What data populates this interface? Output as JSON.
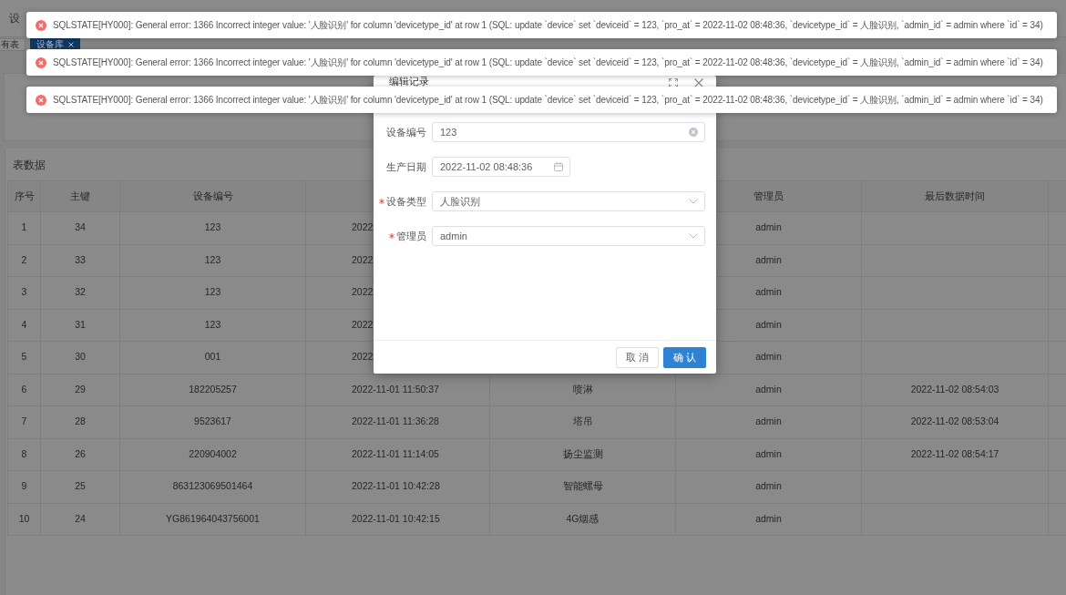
{
  "header": {
    "title": "设"
  },
  "tabs": [
    {
      "label": "有表",
      "selected": false,
      "closable": false
    },
    {
      "label": "设备库",
      "selected": true,
      "closable": true
    }
  ],
  "table": {
    "title": "表数据",
    "columns": {
      "index": "序号",
      "primary_key": "主键",
      "device_no": "设备编号",
      "admin": "管理员",
      "last_data_time": "最后数据时间"
    },
    "rows": [
      {
        "index": "1",
        "primary_key": "34",
        "device_no": "123",
        "column_4": "2022",
        "admin": "admin"
      },
      {
        "index": "2",
        "primary_key": "33",
        "device_no": "123",
        "column_4": "2022",
        "admin": "admin"
      },
      {
        "index": "3",
        "primary_key": "32",
        "device_no": "123",
        "column_4": "2022",
        "admin": "admin"
      },
      {
        "index": "4",
        "primary_key": "31",
        "device_no": "123",
        "column_4": "2022",
        "admin": "admin"
      },
      {
        "index": "5",
        "primary_key": "30",
        "device_no": "001",
        "column_4": "2022",
        "admin": "admin"
      },
      {
        "index": "6",
        "primary_key": "29",
        "device_no": "182205257",
        "column_4": "2022-11-01 11:50:37",
        "column_5": "喷淋",
        "admin": "admin",
        "last_data_time": "2022-11-02 08:54:03"
      },
      {
        "index": "7",
        "primary_key": "28",
        "device_no": "9523617",
        "column_4": "2022-11-01 11:36:28",
        "column_5": "塔吊",
        "admin": "admin",
        "last_data_time": "2022-11-02 08:53:04"
      },
      {
        "index": "8",
        "primary_key": "26",
        "device_no": "220904002",
        "column_4": "2022-11-01 11:14:05",
        "column_5": "扬尘监测",
        "admin": "admin",
        "last_data_time": "2022-11-02 08:54:17"
      },
      {
        "index": "9",
        "primary_key": "25",
        "device_no": "863123069501464",
        "column_4": "2022-11-01 10:42:28",
        "column_5": "智能螺母",
        "admin": "admin"
      },
      {
        "index": "10",
        "primary_key": "24",
        "device_no": "YG861964043756001",
        "column_4": "2022-11-01 10:42:15",
        "column_5": "4G烟感",
        "admin": "admin"
      }
    ]
  },
  "dialog": {
    "title": "编辑记录",
    "fields": [
      {
        "kind": "text",
        "label": "设备编号",
        "required": false,
        "value": "123"
      },
      {
        "kind": "date",
        "label": "生产日期",
        "required": false,
        "value": "2022-11-02 08:48:36"
      },
      {
        "kind": "select",
        "label": "设备类型",
        "required": true,
        "value": "人脸识别"
      },
      {
        "kind": "select",
        "label": "管理员",
        "required": true,
        "value": "admin"
      }
    ],
    "buttons": [
      {
        "kind": "secondary",
        "label": "取消"
      },
      {
        "kind": "primary",
        "label": "确认"
      }
    ]
  },
  "toasts": [
    {
      "kind": "error",
      "text": "SQLSTATE[HY000]: General error: 1366 Incorrect integer value: '人脸识别' for column 'devicetype_id' at row 1 (SQL: update `device` set `deviceid` = 123, `pro_at` = 2022-11-02 08:48:36, `devicetype_id` = 人脸识别, `admin_id` = admin where `id` = 34)"
    },
    {
      "kind": "error",
      "text": "SQLSTATE[HY000]: General error: 1366 Incorrect integer value: '人脸识别' for column 'devicetype_id' at row 1 (SQL: update `device` set `deviceid` = 123, `pro_at` = 2022-11-02 08:48:36, `devicetype_id` = 人脸识别, `admin_id` = admin where `id` = 34)"
    },
    {
      "kind": "error",
      "text": "SQLSTATE[HY000]: General error: 1366 Incorrect integer value: '人脸识别' for column 'devicetype_id' at row 1 (SQL: update `device` set `deviceid` = 123, `pro_at` = 2022-11-02 08:48:36, `devicetype_id` = 人脸识别, `admin_id` = admin where `id` = 34)"
    }
  ]
}
